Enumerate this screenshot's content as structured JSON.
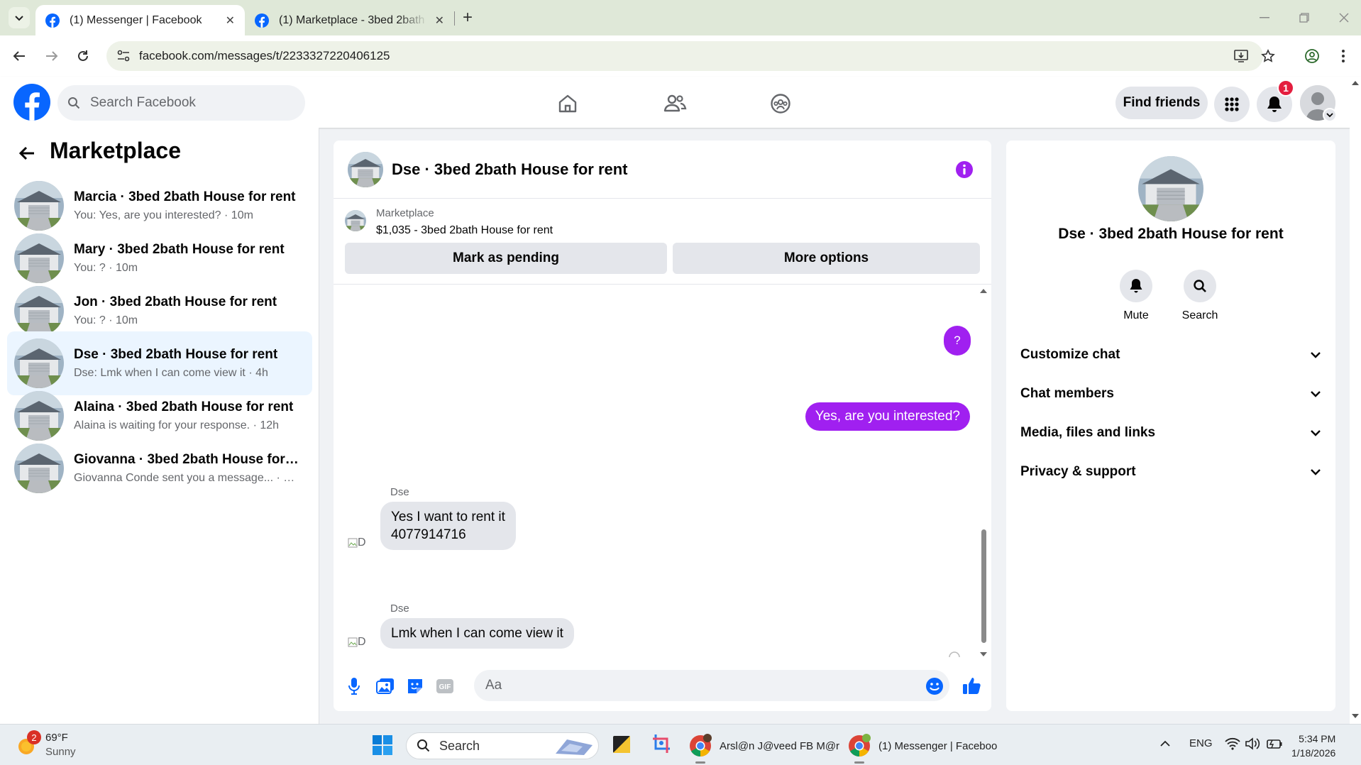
{
  "browser": {
    "tabs": [
      {
        "title": "(1) Messenger | Facebook",
        "active": true
      },
      {
        "title": "(1) Marketplace - 3bed 2bath H",
        "active": false
      }
    ],
    "url": "facebook.com/messages/t/2233327220406125"
  },
  "fb": {
    "search_placeholder": "Search Facebook",
    "find_friends": "Find friends",
    "notification_count": "1",
    "brand_color": "#0866ff"
  },
  "sidebar": {
    "title": "Marketplace",
    "conversations": [
      {
        "name": "Marcia · 3bed 2bath House for rent",
        "preview": "You: Yes, are you interested? · 10m"
      },
      {
        "name": "Mary · 3bed 2bath House for rent",
        "preview": "You: ? · 10m"
      },
      {
        "name": "Jon · 3bed 2bath House for rent",
        "preview": "You: ? · 10m"
      },
      {
        "name": "Dse · 3bed 2bath House for rent",
        "preview": "Dse: Lmk when I can come view it · 4h",
        "active": true
      },
      {
        "name": "Alaina · 3bed 2bath House for rent",
        "preview": "Alaina is waiting for your response. · 12h"
      },
      {
        "name": "Giovanna · 3bed 2bath House for r...",
        "preview": "Giovanna Conde sent you a message... · 19h"
      }
    ]
  },
  "chat": {
    "title": "Dse · 3bed 2bath House for rent",
    "listing_label": "Marketplace",
    "listing_item": "$1,035 - 3bed 2bath House for rent",
    "mark_pending": "Mark as pending",
    "more_options": "More options",
    "messages": [
      {
        "from": "me",
        "text": "?"
      },
      {
        "from": "me",
        "text": "Yes, are you interested?"
      },
      {
        "from": "Dse",
        "sender_label": "Dse",
        "avatar_alt": "D",
        "lines": [
          "Yes I want to rent it",
          "4077914716"
        ]
      },
      {
        "from": "Dse",
        "sender_label": "Dse",
        "avatar_alt": "D",
        "lines": [
          "Lmk when I can come view it"
        ]
      }
    ],
    "input_placeholder": "Aa",
    "accent_color": "#a020f0"
  },
  "info_panel": {
    "title": "Dse · 3bed 2bath House for rent",
    "mute": "Mute",
    "search": "Search",
    "sections": [
      "Customize chat",
      "Chat members",
      "Media, files and links",
      "Privacy & support"
    ]
  },
  "taskbar": {
    "weather_temp": "69°F",
    "weather_desc": "Sunny",
    "weather_badge": "2",
    "search": "Search",
    "apps": [
      {
        "label": "Arsl@n J@veed FB M@r"
      },
      {
        "label": "(1) Messenger | Faceboo"
      }
    ],
    "language": "ENG",
    "time": "5:34 PM",
    "date": "1/18/2026"
  }
}
